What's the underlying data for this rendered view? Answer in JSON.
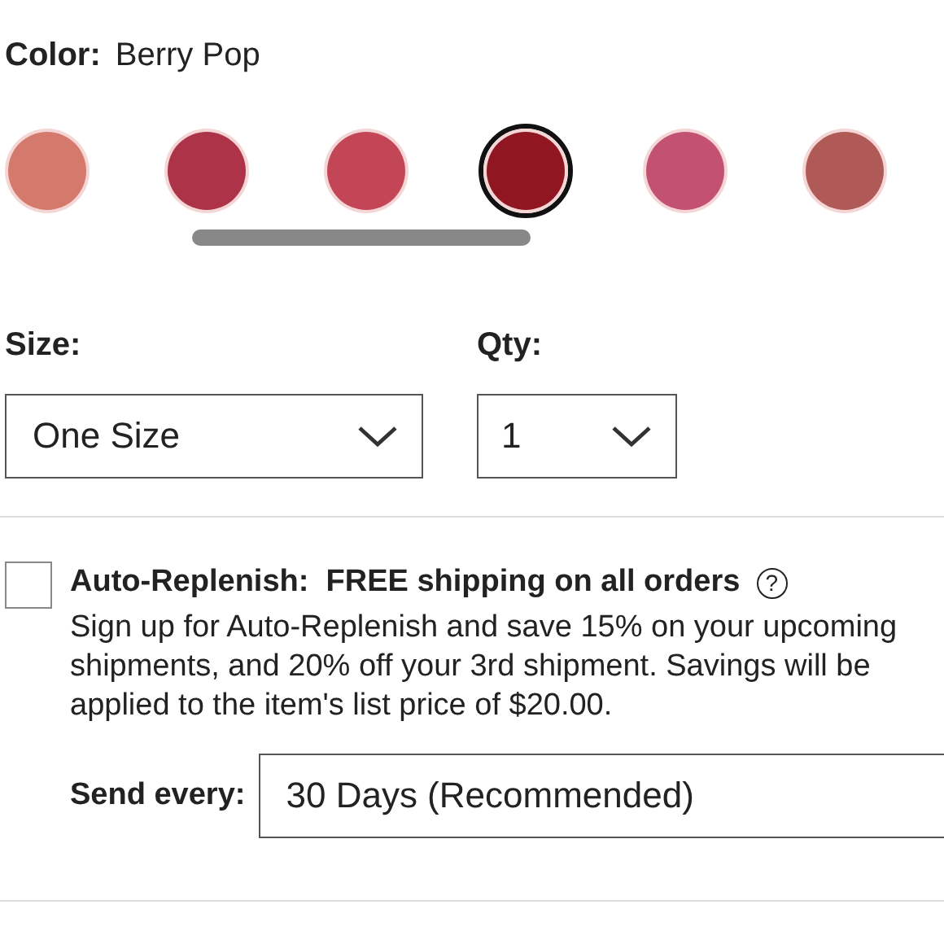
{
  "color": {
    "label": "Color:",
    "value": "Berry Pop",
    "swatches": [
      {
        "color": "#d47a6c",
        "selected": false
      },
      {
        "color": "#ad3349",
        "selected": false
      },
      {
        "color": "#c24656",
        "selected": false
      },
      {
        "color": "#901722",
        "selected": true
      },
      {
        "color": "#c25172",
        "selected": false
      },
      {
        "color": "#b05a58",
        "selected": false
      }
    ]
  },
  "size": {
    "label": "Size:",
    "value": "One Size"
  },
  "qty": {
    "label": "Qty:",
    "value": "1"
  },
  "auto_replenish": {
    "checked": false,
    "title": "Auto-Replenish:  FREE shipping on all orders",
    "help_icon": "?",
    "description": "Sign up for Auto-Replenish and save 15% on your upcoming shipments, and 20% off your 3rd shipment. Savings will be applied to the item's list price of $20.00.",
    "frequency_label": "Send every:",
    "frequency_value": "30 Days (Recommended)"
  }
}
